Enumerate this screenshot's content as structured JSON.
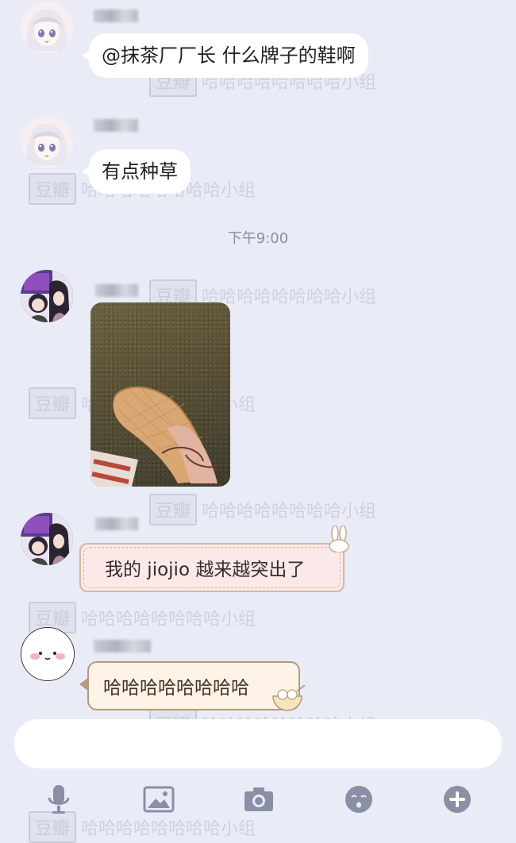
{
  "messages": [
    {
      "text": "@抹茶厂厂长 什么牌子的鞋啊"
    },
    {
      "text": "有点种草"
    },
    {
      "text": "我的 jiojio 越来越突出了"
    },
    {
      "text": "哈哈哈哈哈哈哈哈"
    }
  ],
  "timestamp": "下午9:00",
  "watermark": {
    "logo": "豆瓣",
    "group": "哈哈哈哈哈哈哈哈小组"
  },
  "toolbar": {
    "items": [
      "microphone-icon",
      "image-icon",
      "camera-icon",
      "emoji-icon",
      "plus-icon"
    ]
  },
  "colors": {
    "background": "#e9ebf7",
    "bubble": "#ffffff",
    "icon": "#8a8fa6"
  }
}
